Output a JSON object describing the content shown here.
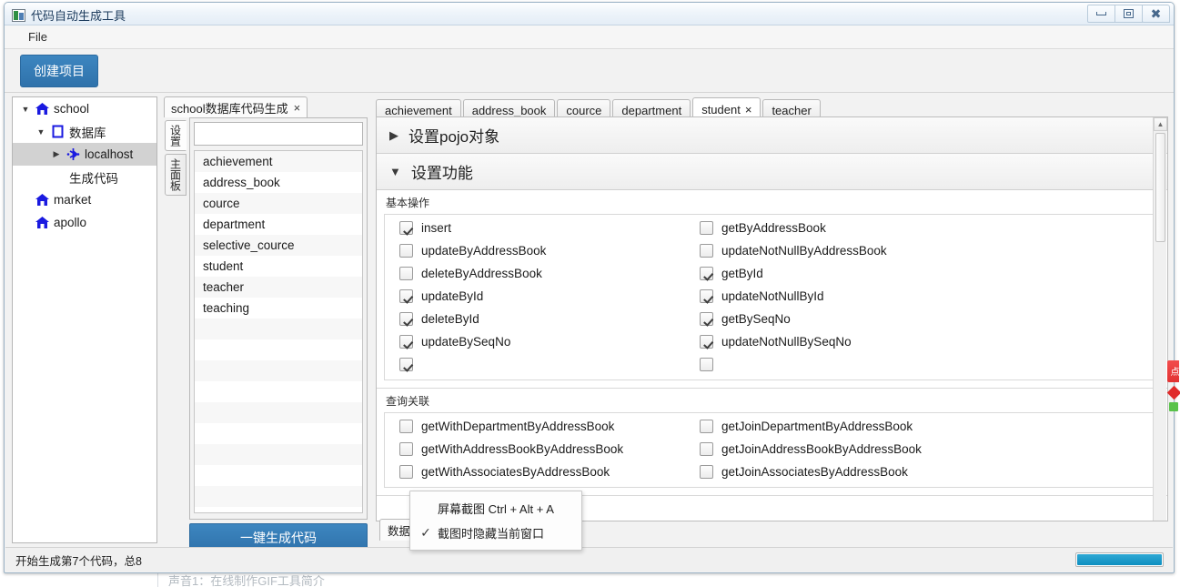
{
  "window": {
    "title": "代码自动生成工具",
    "app_icon": "app-window-icon",
    "controls": {
      "minimize": "minimize-icon",
      "maximize": "maximize-icon",
      "close": "close-icon"
    }
  },
  "menubar": {
    "items": [
      {
        "label": "File"
      }
    ]
  },
  "toolbar": {
    "create_project_label": "创建项目"
  },
  "tree": {
    "items": [
      {
        "label": "school",
        "icon": "home-icon",
        "twisty": "▼",
        "indent": 0,
        "selected": false
      },
      {
        "label": "数据库",
        "icon": "database-icon",
        "twisty": "▼",
        "indent": 1,
        "selected": false
      },
      {
        "label": "localhost",
        "icon": "connection-icon",
        "twisty": "▶",
        "indent": 2,
        "selected": true
      },
      {
        "label": "生成代码",
        "icon": "none",
        "twisty": "",
        "indent": 1,
        "selected": false
      },
      {
        "label": "market",
        "icon": "home-icon",
        "twisty": "",
        "indent": 0,
        "selected": false
      },
      {
        "label": "apollo",
        "icon": "home-icon",
        "twisty": "",
        "indent": 0,
        "selected": false
      }
    ]
  },
  "mid_panel": {
    "doc_tab": {
      "label": "school数据库代码生成",
      "close": "×"
    },
    "vertical_tabs": [
      {
        "label": "设置",
        "active": true
      },
      {
        "label": "主面板",
        "active": false
      }
    ],
    "search": {
      "value": "",
      "placeholder": ""
    },
    "tables": [
      "achievement",
      "address_book",
      "cource",
      "department",
      "selective_cource",
      "student",
      "teacher",
      "teaching"
    ],
    "empty_row_count": 11,
    "generate_button_label": "一键生成代码"
  },
  "main_panel": {
    "tabs": [
      {
        "label": "achievement",
        "active": false,
        "closable": false
      },
      {
        "label": "address_book",
        "active": false,
        "closable": false
      },
      {
        "label": "cource",
        "active": false,
        "closable": false
      },
      {
        "label": "department",
        "active": false,
        "closable": false
      },
      {
        "label": "student",
        "active": true,
        "closable": true,
        "close": "×"
      },
      {
        "label": "teacher",
        "active": false,
        "closable": false
      }
    ],
    "sections": [
      {
        "title": "设置pojo对象",
        "expanded": false,
        "arrow": "▶"
      },
      {
        "title": "设置功能",
        "expanded": true,
        "arrow": "▼"
      }
    ],
    "groups": [
      {
        "label": "基本操作",
        "rows": [
          {
            "left": {
              "label": "insert",
              "checked": true
            },
            "right": {
              "label": "getByAddressBook",
              "checked": false
            }
          },
          {
            "left": {
              "label": "updateByAddressBook",
              "checked": false
            },
            "right": {
              "label": "updateNotNullByAddressBook",
              "checked": false
            }
          },
          {
            "left": {
              "label": "deleteByAddressBook",
              "checked": false
            },
            "right": {
              "label": "getById",
              "checked": true
            }
          },
          {
            "left": {
              "label": "updateById",
              "checked": true
            },
            "right": {
              "label": "updateNotNullById",
              "checked": true
            }
          },
          {
            "left": {
              "label": "deleteById",
              "checked": true
            },
            "right": {
              "label": "getBySeqNo",
              "checked": true
            }
          },
          {
            "left": {
              "label": "updateBySeqNo",
              "checked": true
            },
            "right": {
              "label": "updateNotNullBySeqNo",
              "checked": true
            }
          },
          {
            "left": {
              "label": "",
              "checked": true
            },
            "right": {
              "label": "",
              "checked": false
            }
          }
        ]
      },
      {
        "label": "查询关联",
        "rows": [
          {
            "left": {
              "label": "getWithDepartmentByAddressBook",
              "checked": false
            },
            "right": {
              "label": "getJoinDepartmentByAddressBook",
              "checked": false
            }
          },
          {
            "left": {
              "label": "getWithAddressBookByAddressBook",
              "checked": false
            },
            "right": {
              "label": "getJoinAddressBookByAddressBook",
              "checked": false
            }
          },
          {
            "left": {
              "label": "getWithAssociatesByAddressBook",
              "checked": false
            },
            "right": {
              "label": "getJoinAssociatesByAddressBook",
              "checked": false
            }
          }
        ]
      }
    ],
    "bottom_tab": {
      "label": "数据"
    },
    "scrollbar": {
      "up_arrow": "▲"
    }
  },
  "popup_menu": {
    "items": [
      {
        "label": "屏幕截图 Ctrl + Alt + A",
        "checked": false,
        "check": ""
      },
      {
        "label": "截图时隐藏当前窗口",
        "checked": true,
        "check": "✓"
      }
    ]
  },
  "statusbar": {
    "text": "开始生成第7个代码，总8",
    "progress_percent": 100
  },
  "float_widget": {
    "label": "点",
    "accent_color": "#e23232"
  },
  "background": {
    "under_text": "声音1：在线制作GIF工具简介"
  },
  "colors": {
    "accent_blue": "#2f72ab",
    "progress_blue": "#0d8fc0",
    "tree_icon_blue": "#1a1ae0",
    "selection_gray": "#d2d2d2",
    "window_border": "#9bb3c6"
  }
}
